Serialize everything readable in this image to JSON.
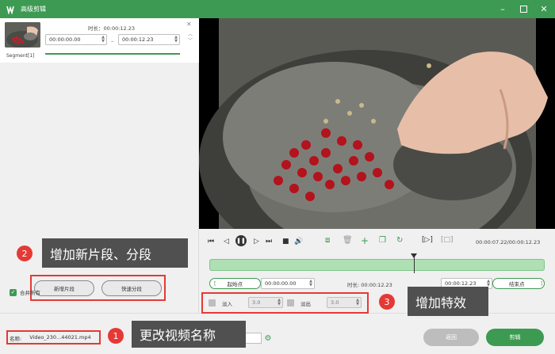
{
  "window": {
    "title": "高级剪辑"
  },
  "segment": {
    "label": "Segment[1]",
    "duration_label": "时长：00:00:12.23",
    "start_time": "00:00:00.00",
    "end_time": "00:00:12.23"
  },
  "left_buttons": {
    "new_segment": "新增片段",
    "quick_split": "快速分段"
  },
  "merge_all": {
    "label": "合并所有",
    "checked": true
  },
  "filename": {
    "label": "名称:",
    "value": "Video_230...44021.mp4"
  },
  "annotations": {
    "a1": {
      "num": "1",
      "text": "更改视频名称"
    },
    "a2": {
      "num": "2",
      "text": "增加新片段、分段"
    },
    "a3": {
      "num": "3",
      "text": "增加特效"
    }
  },
  "player": {
    "time_display": "00:00:07.22/00:00:12.23"
  },
  "range": {
    "start_btn": "起始点",
    "start_time": "00:00:00.00",
    "duration_label": "时长: 00:00:12.23",
    "end_time": "00:00:12.23",
    "end_btn": "结束点"
  },
  "effects": {
    "fade_in_label": "淡入",
    "fade_in_value": "3.0",
    "fade_out_label": "淡出",
    "fade_out_value": "3.0"
  },
  "footer": {
    "back": "返回",
    "cut": "剪辑"
  },
  "colors": {
    "brand": "#3d9a53",
    "annotation": "#e53935",
    "callout_bg": "#505050"
  }
}
